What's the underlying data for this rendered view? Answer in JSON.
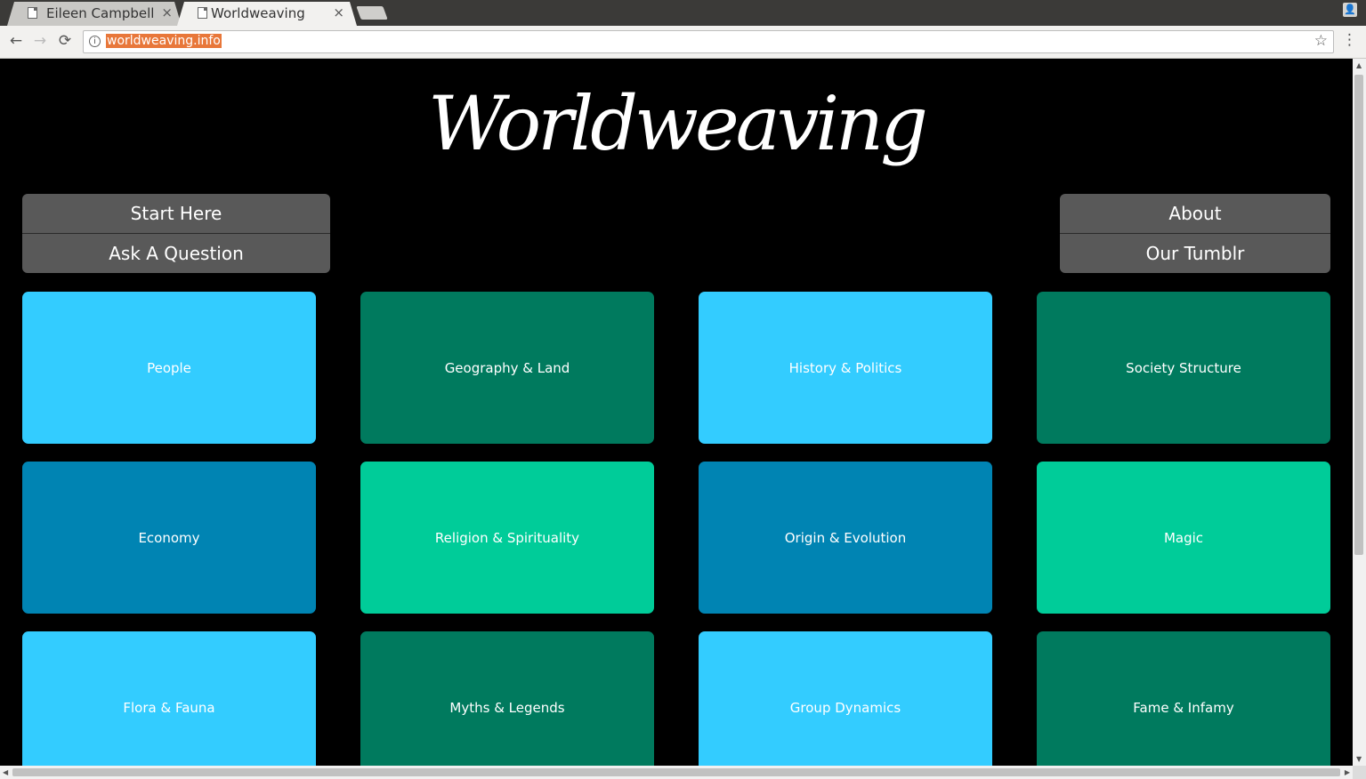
{
  "browser": {
    "tabs": [
      {
        "title": "Eileen Campbell",
        "close": "×"
      },
      {
        "title": "Worldweaving",
        "close": "×"
      }
    ],
    "url": "worldweaving.info",
    "icons": {
      "back": "←",
      "forward": "→",
      "reload": "⟳",
      "info": "i",
      "star": "☆",
      "menu": "⋮",
      "profile": "👤"
    }
  },
  "site": {
    "logo": "Worldweaving",
    "menu_left": [
      "Start Here",
      "Ask A Question"
    ],
    "menu_right": [
      "About",
      "Our Tumblr"
    ]
  },
  "tiles": [
    {
      "label": "People",
      "color": "#33ccff"
    },
    {
      "label": "Geography & Land",
      "color": "#007a5e"
    },
    {
      "label": "History & Politics",
      "color": "#33ccff"
    },
    {
      "label": "Society Structure",
      "color": "#007a5e"
    },
    {
      "label": "Economy",
      "color": "#0084b3"
    },
    {
      "label": "Religion & Spirituality",
      "color": "#00cc99"
    },
    {
      "label": "Origin & Evolution",
      "color": "#0084b3"
    },
    {
      "label": "Magic",
      "color": "#00cc99"
    },
    {
      "label": "Flora & Fauna",
      "color": "#33ccff"
    },
    {
      "label": "Myths & Legends",
      "color": "#007a5e"
    },
    {
      "label": "Group Dynamics",
      "color": "#33ccff"
    },
    {
      "label": "Fame & Infamy",
      "color": "#007a5e"
    }
  ]
}
